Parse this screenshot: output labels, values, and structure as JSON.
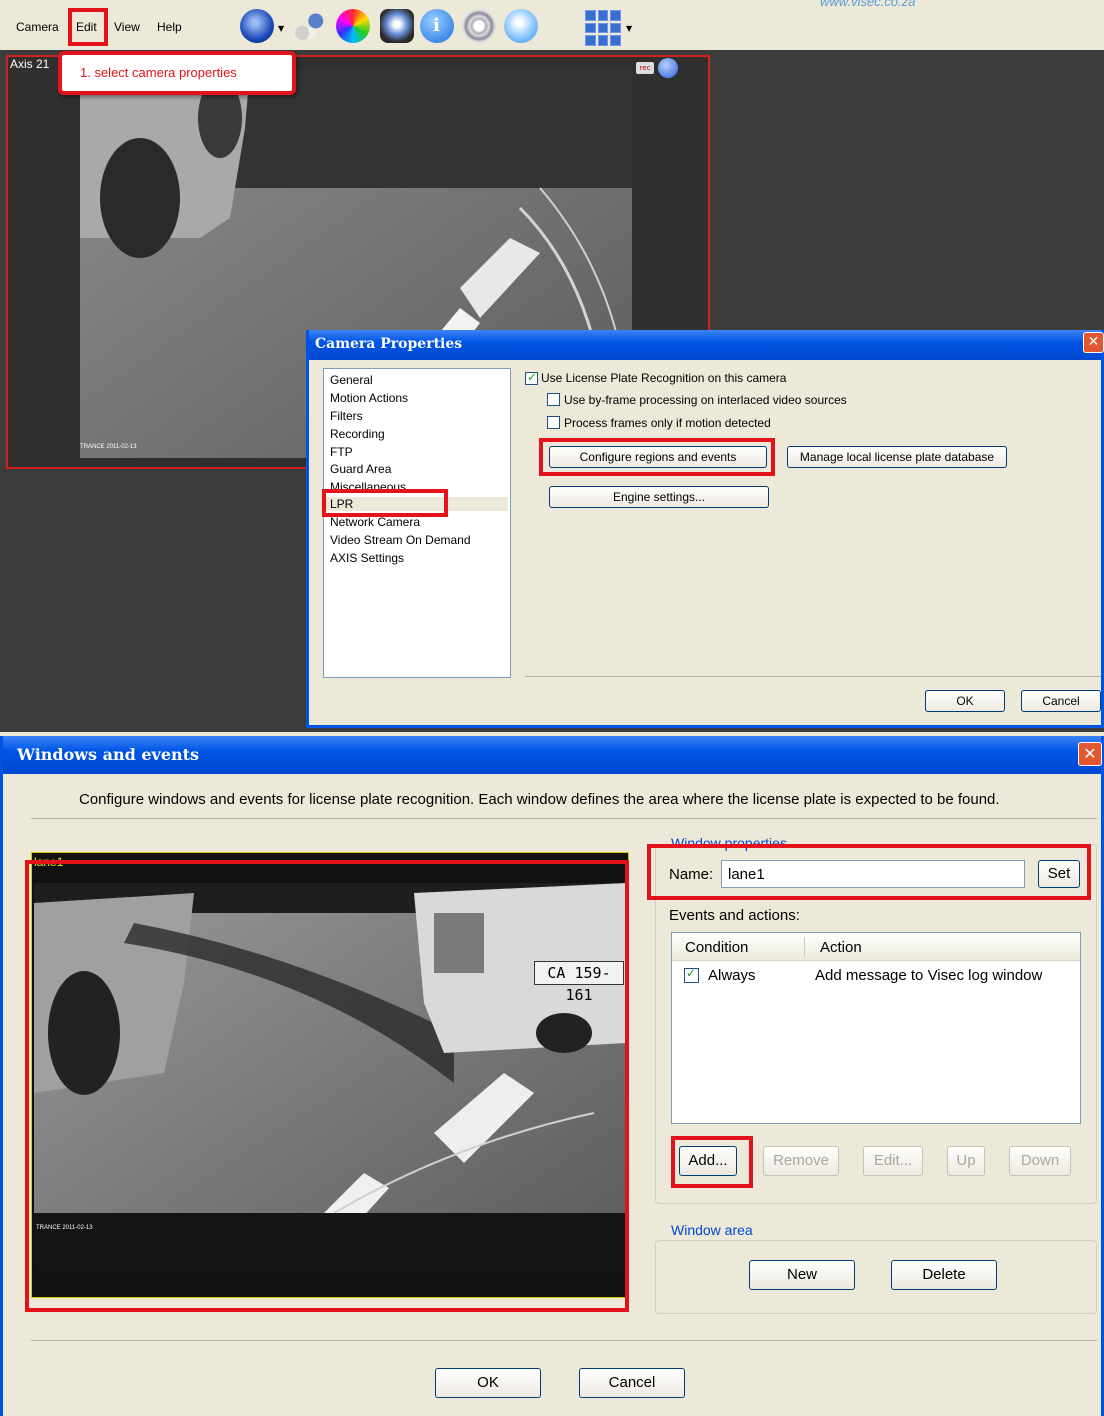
{
  "menu": {
    "camera": "Camera",
    "edit": "Edit",
    "view": "View",
    "help": "Help"
  },
  "watermark": "www.visec.co.za",
  "callout": "1. select camera properties",
  "camera_window": {
    "label": "Axis 21",
    "rec": "rec",
    "overlay_stamp": "TRANCE 2011-02-13"
  },
  "camera_properties": {
    "title": "Camera Properties",
    "close": "✕",
    "categories": [
      "General",
      "Motion Actions",
      "Filters",
      "Recording",
      "FTP",
      "Guard Area",
      "Miscellaneous",
      "LPR",
      "Network Camera",
      "Video Stream On Demand",
      "AXIS Settings"
    ],
    "selected": "LPR",
    "use_lpr": "Use License Plate Recognition on this camera",
    "use_lpr_checked": true,
    "by_frame": "Use by-frame processing on interlaced video sources",
    "by_frame_checked": false,
    "motion_only": "Process frames only if motion detected",
    "motion_only_checked": false,
    "configure_btn": "Configure regions and events",
    "manage_btn": "Manage local license plate database",
    "engine_btn": "Engine settings...",
    "ok": "OK",
    "cancel": "Cancel"
  },
  "windows_events": {
    "title": "Windows and events",
    "close": "✕",
    "description": "Configure windows and events for license plate recognition. Each window defines the area where the license plate is expected to be found.",
    "window_label": "lane1",
    "plate_text": "CA 159-161",
    "stamp": "TRANCE 2011-02-13",
    "window_properties": "Window properties",
    "name_label": "Name:",
    "name_value": "lane1",
    "set": "Set",
    "events_label": "Events and actions:",
    "columns": [
      "Condition",
      "Action"
    ],
    "rows": [
      {
        "condition": "Always",
        "action": "Add message to Visec log window",
        "checked": true
      }
    ],
    "add": "Add...",
    "remove": "Remove",
    "edit": "Edit...",
    "up": "Up",
    "down": "Down",
    "window_area": "Window area",
    "new": "New",
    "delete": "Delete",
    "ok": "OK",
    "cancel": "Cancel"
  }
}
